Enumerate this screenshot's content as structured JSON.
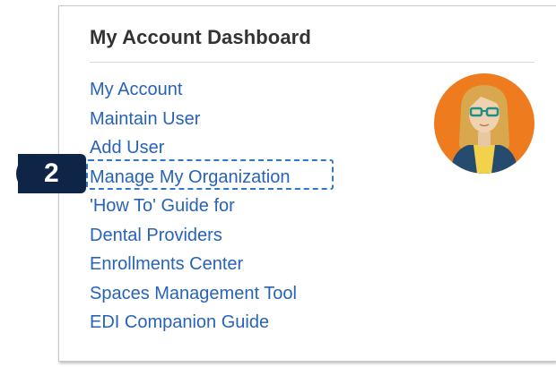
{
  "dashboard": {
    "title": "My Account Dashboard",
    "links": [
      "My Account",
      "Maintain User",
      "Add User",
      "Manage My Organization",
      "'How To' Guide for",
      "Dental Providers",
      "Enrollments Center",
      "Spaces Management Tool",
      "EDI Companion Guide"
    ]
  },
  "callout": {
    "step": "2"
  },
  "colors": {
    "link": "#2763b6",
    "title": "#333333",
    "avatar_bg": "#ee7c1e",
    "badge_bg": "#0f2547",
    "highlight": "#2d79c7"
  },
  "icons": {
    "avatar": "user-avatar-icon"
  }
}
